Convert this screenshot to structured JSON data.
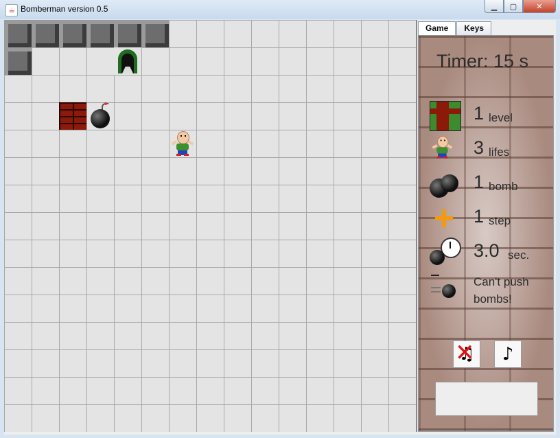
{
  "window": {
    "title": "Bomberman version 0.5",
    "min_glyph": "▁",
    "max_glyph": "▢",
    "close_glyph": "✕"
  },
  "tabs": [
    {
      "label": "Game",
      "active": true
    },
    {
      "label": "Keys",
      "active": false
    }
  ],
  "stats": {
    "timer": "Timer: 15 s",
    "level_num": "1",
    "level_unit": "level",
    "lifes_num": "3",
    "lifes_unit": "lifes",
    "bomb_num": "1",
    "bomb_unit": "bomb",
    "step_num": "1",
    "step_unit": "step",
    "fuse_num": "3.0",
    "fuse_unit": "sec.",
    "push_text": "Can't push bombs!"
  },
  "board": {
    "cols": 15,
    "rows": 15,
    "blocks": [
      [
        0,
        0
      ],
      [
        1,
        0
      ],
      [
        2,
        0
      ],
      [
        3,
        0
      ],
      [
        4,
        0
      ],
      [
        5,
        0
      ],
      [
        0,
        1
      ]
    ],
    "bricks": [
      [
        2,
        3
      ]
    ],
    "exits": [
      [
        4,
        1
      ]
    ],
    "bombs": [
      [
        3,
        3
      ]
    ],
    "player": [
      6,
      4
    ]
  },
  "controls": {
    "sound_glyph": "♫",
    "music_glyph": "♪",
    "sound_muted": true
  }
}
